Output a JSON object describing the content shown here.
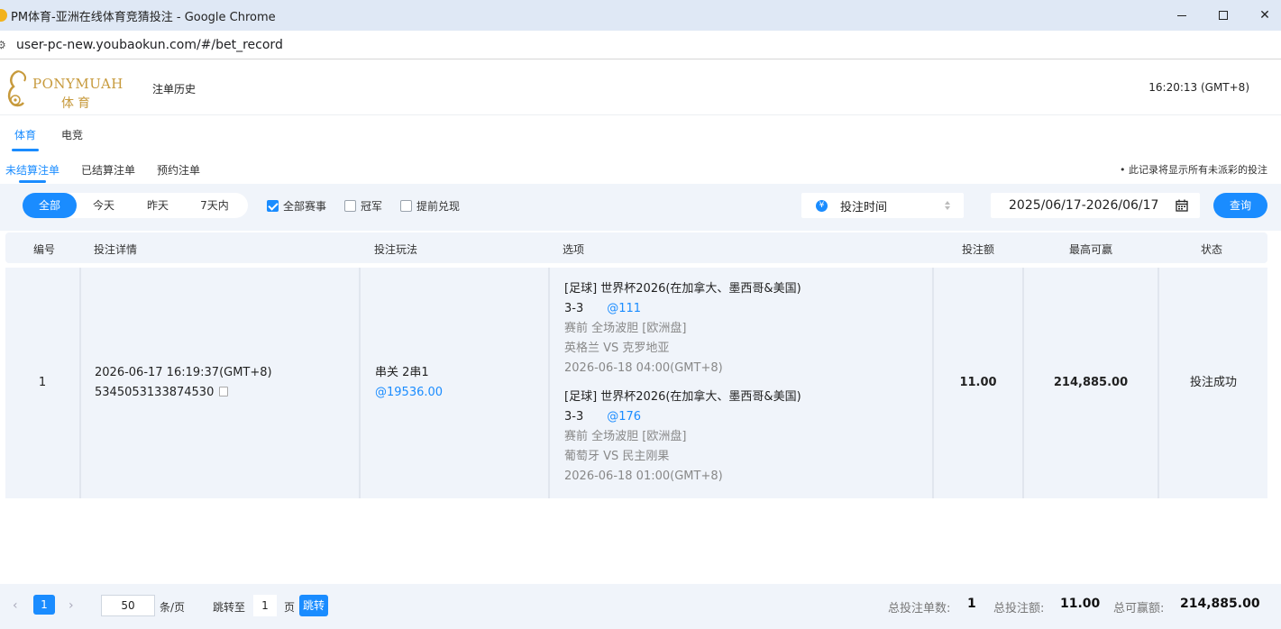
{
  "window": {
    "title": "PM体育-亚洲在线体育竞猜投注 - Google Chrome"
  },
  "browser": {
    "url": "user-pc-new.youbaokun.com/#/bet_record"
  },
  "header": {
    "brand": "PONYMUAH",
    "brand_cn": "体育",
    "page_title": "注单历史",
    "clock": "16:20:13 (GMT+8)"
  },
  "sport_tabs": [
    {
      "label": "体育",
      "active": true
    },
    {
      "label": "电竞",
      "active": false
    }
  ],
  "status_tabs": [
    {
      "label": "未结算注单",
      "active": true
    },
    {
      "label": "已结算注单",
      "active": false
    },
    {
      "label": "预约注单",
      "active": false
    }
  ],
  "notice": "• 此记录将显示所有未派彩的投注",
  "filters": {
    "ranges": [
      "全部",
      "今天",
      "昨天",
      "7天内"
    ],
    "active_range": "全部",
    "checkboxes": [
      {
        "label": "全部赛事",
        "checked": true
      },
      {
        "label": "冠军",
        "checked": false
      },
      {
        "label": "提前兑现",
        "checked": false
      }
    ],
    "sort_label": "投注时间",
    "date_range": "2025/06/17-2026/06/17",
    "query_label": "查询"
  },
  "table": {
    "columns": [
      "编号",
      "投注详情",
      "投注玩法",
      "选项",
      "投注额",
      "最高可赢",
      "状态"
    ],
    "rows": [
      {
        "index": "1",
        "detail_time": "2026-06-17 16:19:37(GMT+8)",
        "detail_id": "5345053133874530",
        "play_type": "串关 2串1",
        "play_odds": "@19536.00",
        "options": [
          {
            "league": "[足球] 世界杯2026(在加拿大、墨西哥&美国)",
            "pick": "3-3",
            "odds": "@111",
            "market": "赛前 全场波胆 [欧洲盘]",
            "match": "英格兰 VS 克罗地亚",
            "time": "2026-06-18 04:00(GMT+8)"
          },
          {
            "league": "[足球] 世界杯2026(在加拿大、墨西哥&美国)",
            "pick": "3-3",
            "odds": "@176",
            "market": "赛前 全场波胆 [欧洲盘]",
            "match": "葡萄牙 VS 民主刚果",
            "time": "2026-06-18 01:00(GMT+8)"
          }
        ],
        "stake": "11.00",
        "max_win": "214,885.00",
        "status": "投注成功"
      }
    ]
  },
  "pagination": {
    "current_page": "1",
    "page_size": "50",
    "per_page_label": "条/页",
    "jump_label": "跳转至",
    "jump_value": "1",
    "page_label": "页",
    "jump_button": "跳转"
  },
  "summary": {
    "count_label": "总投注单数:",
    "count_value": "1",
    "stake_label": "总投注额:",
    "stake_value": "11.00",
    "win_label": "总可赢额:",
    "win_value": "214,885.00"
  },
  "colors": {
    "accent": "#1a8cff",
    "brand_gold": "#c79a3c",
    "panel_bg": "#f0f4fa"
  }
}
